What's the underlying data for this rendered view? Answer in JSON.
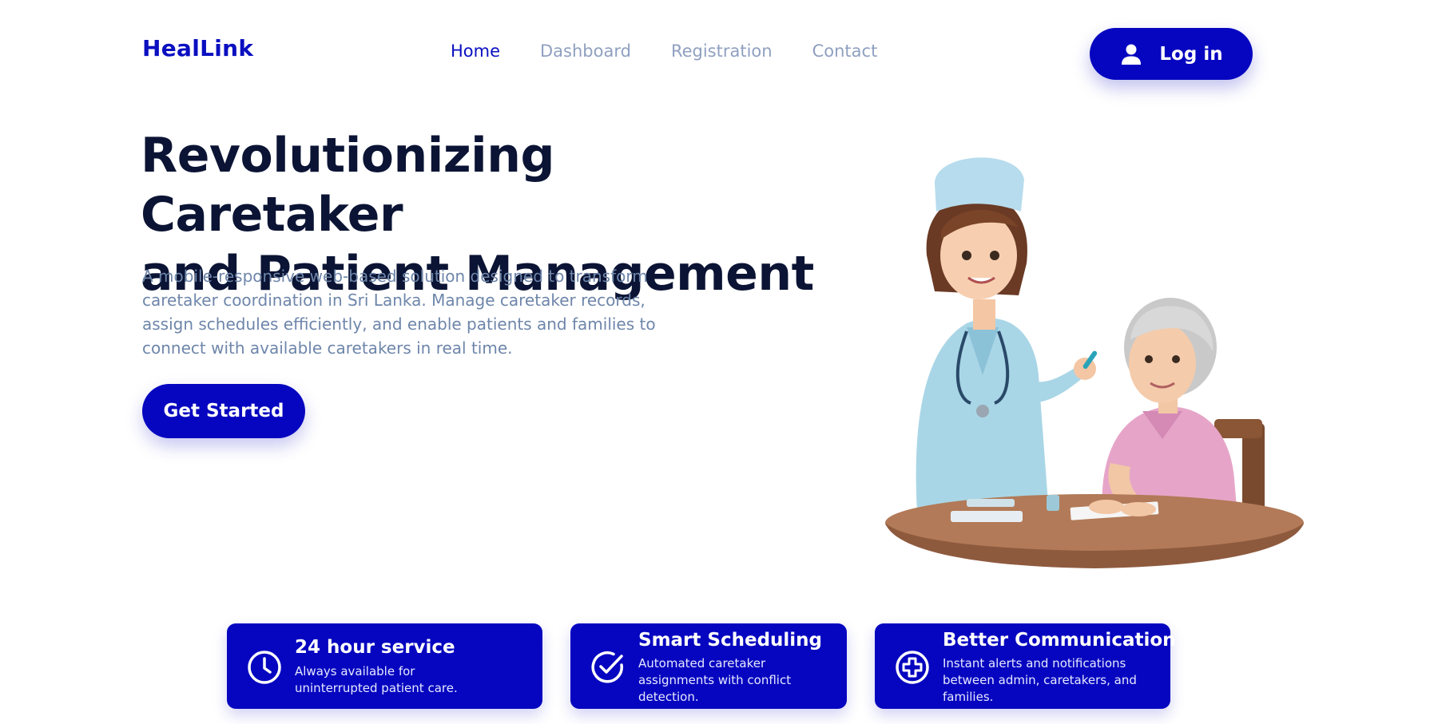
{
  "brand": {
    "name": "HealLink",
    "color": "#0606c0"
  },
  "nav": {
    "items": [
      {
        "label": "Home",
        "active": true
      },
      {
        "label": "Dashboard",
        "active": false
      },
      {
        "label": "Registration",
        "active": false
      },
      {
        "label": "Contact",
        "active": false
      }
    ]
  },
  "header": {
    "login_label": "Log in",
    "login_icon": "user-icon"
  },
  "hero": {
    "title_line1": "Revolutionizing Caretaker",
    "title_line2": "and Patient Management",
    "description": "A mobile-responsive web-based solution designed to transform caretaker coordination in Sri Lanka. Manage caretaker records, assign schedules efficiently, and enable patients and families to connect with available caretakers in real time.",
    "cta_label": "Get Started",
    "illustration": "nurse-with-elderly-patient-illustration"
  },
  "features": [
    {
      "icon": "clock-icon",
      "title": "24 hour service",
      "description": "Always available for uninterrupted patient care."
    },
    {
      "icon": "check-circle-icon",
      "title": "Smart Scheduling",
      "description": "Automated caretaker assignments with conflict detection."
    },
    {
      "icon": "medical-cross-icon",
      "title": "Better Communication",
      "description": "Instant alerts and notifications between admin, caretakers, and families."
    }
  ]
}
